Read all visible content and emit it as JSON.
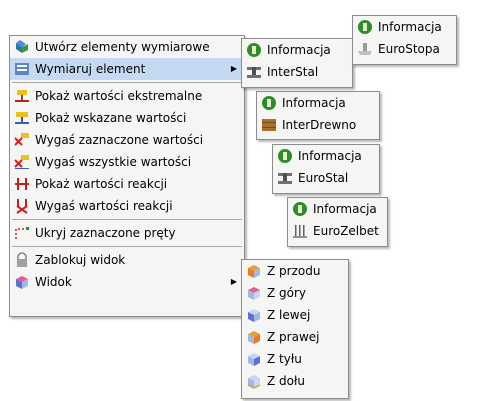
{
  "main_menu": {
    "items": [
      {
        "label": "Utwórz elementy wymiarowe",
        "icon": "dimension-elements-icon"
      },
      {
        "label": "Wymiaruj element",
        "icon": "dimension-element-icon"
      },
      {
        "label": "Pokaż wartości ekstremalne",
        "icon": "extreme-values-icon"
      },
      {
        "label": "Pokaż wskazane wartości",
        "icon": "indicated-values-icon"
      },
      {
        "label": "Wygaś zaznaczone wartości",
        "icon": "hide-selected-values-icon"
      },
      {
        "label": "Wygaś wszystkie wartości",
        "icon": "hide-all-values-icon"
      },
      {
        "label": "Pokaż wartości reakcji",
        "icon": "show-reactions-icon"
      },
      {
        "label": "Wygaś wartości reakcji",
        "icon": "hide-reactions-icon"
      },
      {
        "label": "Ukryj zaznaczone pręty",
        "icon": "hide-bars-icon"
      },
      {
        "label": "Zablokuj widok",
        "icon": "lock-icon"
      },
      {
        "label": "Widok",
        "icon": "view-cube-icon"
      }
    ]
  },
  "submenus": {
    "interstal": {
      "items": [
        {
          "label": "Informacja",
          "icon": "info-icon"
        },
        {
          "label": "InterStal",
          "icon": "steel-icon"
        }
      ]
    },
    "eurostopa": {
      "items": [
        {
          "label": "Informacja",
          "icon": "info-icon"
        },
        {
          "label": "EuroStopa",
          "icon": "footing-icon"
        }
      ]
    },
    "interdrewno": {
      "items": [
        {
          "label": "Informacja",
          "icon": "info-icon"
        },
        {
          "label": "InterDrewno",
          "icon": "timber-icon"
        }
      ]
    },
    "eurostal": {
      "items": [
        {
          "label": "Informacja",
          "icon": "info-icon"
        },
        {
          "label": "EuroStal",
          "icon": "steel-icon"
        }
      ]
    },
    "eurozelbet": {
      "items": [
        {
          "label": "Informacja",
          "icon": "info-icon"
        },
        {
          "label": "EuroZelbet",
          "icon": "concrete-icon"
        }
      ]
    }
  },
  "view_menu": {
    "items": [
      {
        "label": "Z przodu",
        "icon": "view-front-icon"
      },
      {
        "label": "Z góry",
        "icon": "view-top-icon"
      },
      {
        "label": "Z lewej",
        "icon": "view-left-icon"
      },
      {
        "label": "Z prawej",
        "icon": "view-right-icon"
      },
      {
        "label": "Z tyłu",
        "icon": "view-back-icon"
      },
      {
        "label": "Z dołu",
        "icon": "view-bottom-icon"
      }
    ]
  },
  "colors": {
    "menu_bg": "#f5f5f3",
    "highlight": "#c6d9f2",
    "info_green": "#2e8b2e"
  }
}
